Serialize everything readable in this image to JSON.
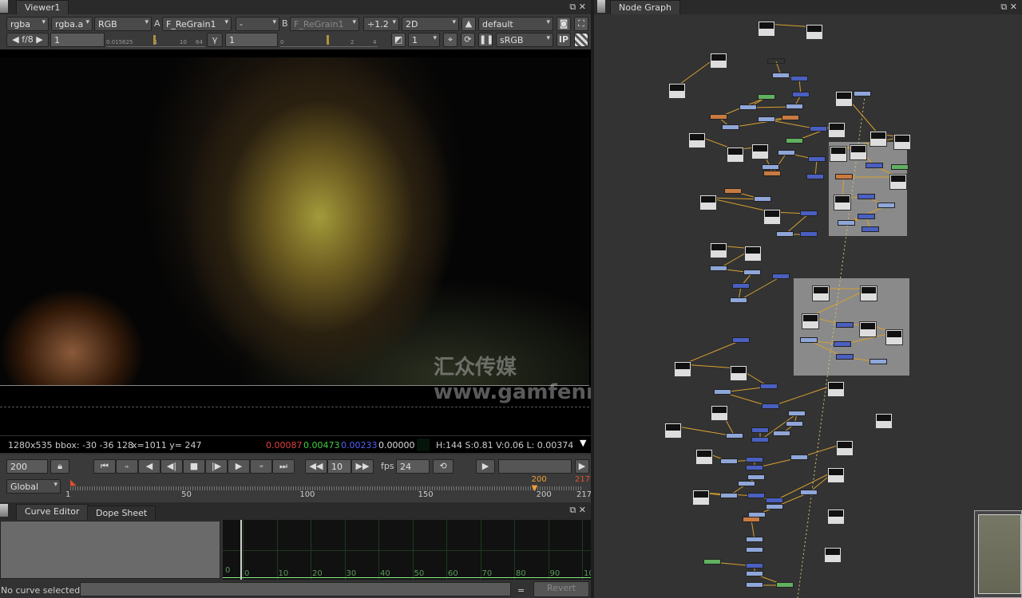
{
  "viewer": {
    "tab": "Viewer1",
    "toolbar1": {
      "channels": "rgba",
      "alpha": "rgba.a",
      "display": "RGB",
      "a_label": "A",
      "a_input": "F_ReGrain1",
      "op": "-",
      "b_label": "B",
      "b_input": "F_ReGrain1",
      "zoom": "÷1.2",
      "mode": "2D",
      "lut_group": "default"
    },
    "toolbar2": {
      "fstop": "f/8",
      "gain": "1",
      "gain_ticks": [
        "0.015625",
        "1",
        "10",
        "64"
      ],
      "gamma_label": "γ",
      "gamma": "1",
      "gamma_ticks": [
        "0",
        "1",
        "2",
        "4"
      ],
      "proxy": "1",
      "colorspace": "sRGB",
      "ip": "IP"
    },
    "watermark": "汇众传媒 www.gamfenmedia.com",
    "info": {
      "format": "1280x535 bbox: -30 -36 128",
      "coords": "x=1011 y= 247",
      "r": "0.00087",
      "g": "0.00473",
      "b": "0.00233",
      "a": "0.00000",
      "hsvl": "H:144 S:0.81 V:0.06  L: 0.00374"
    },
    "playback": {
      "frame": "200",
      "increment": "10",
      "fps_label": "fps",
      "fps": "24"
    },
    "timeline": {
      "range": "Global",
      "in": "1",
      "out": "217",
      "current": "200",
      "ticks": [
        "1",
        "50",
        "100",
        "150",
        "200",
        "217"
      ]
    }
  },
  "curve": {
    "tabs": [
      "Curve Editor",
      "Dope Sheet"
    ],
    "y0": "0",
    "xticks": [
      "0",
      "10",
      "20",
      "30",
      "40",
      "50",
      "60",
      "70",
      "80",
      "90",
      "100"
    ],
    "status": "No curve selected",
    "equals": "=",
    "revert": "Revert"
  },
  "nodegraph": {
    "tab": "Node Graph"
  },
  "colors": {
    "accent_orange": "#f0a030",
    "node_blue": "#4a5fc0",
    "node_lightblue": "#8fa6d8",
    "node_orange": "#c87a40",
    "node_green": "#60b060",
    "backdrop": "#8a8a8a"
  }
}
